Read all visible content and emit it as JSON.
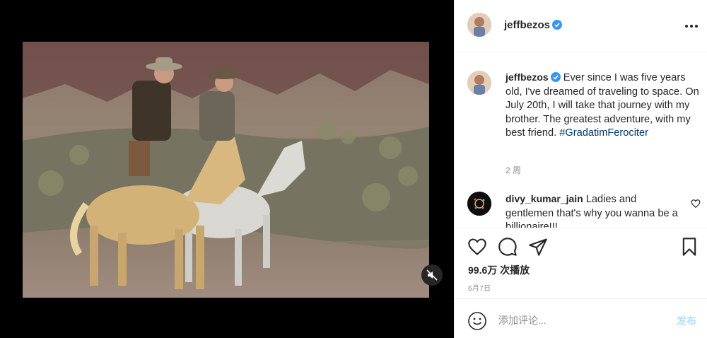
{
  "post": {
    "author": "jeffbezos",
    "verified_icon": "verified-badge-icon",
    "more_icon": "more-options-icon",
    "caption": "Ever since I was five years old, I've dreamed of traveling to space. On July 20th, I will take that journey with my brother. The greatest adventure, with my best friend.",
    "hashtag": "#GradatimFerociter",
    "time_ago": "2 周",
    "media": {
      "type": "video",
      "description_icon": "horse-riders-photo",
      "mute_icon": "speaker-muted-icon"
    }
  },
  "comments": [
    {
      "username": "divy_kumar_jain",
      "text": "Ladies and gentlemen that's why you wanna be a billionaire!!!"
    }
  ],
  "actions": {
    "like_icon": "heart-icon",
    "comment_icon": "comment-bubble-icon",
    "share_icon": "paper-plane-icon",
    "save_icon": "bookmark-icon",
    "views": "99.6万 次播放",
    "date": "6月7日"
  },
  "add_comment": {
    "placeholder": "添加评论...",
    "post_label": "发布",
    "emoji_icon": "smiley-icon"
  },
  "colors": {
    "verified": "#3897f0",
    "hashtag": "#00376b",
    "post_disabled": "#b2dffc",
    "muted_text": "#8e8e8e"
  }
}
